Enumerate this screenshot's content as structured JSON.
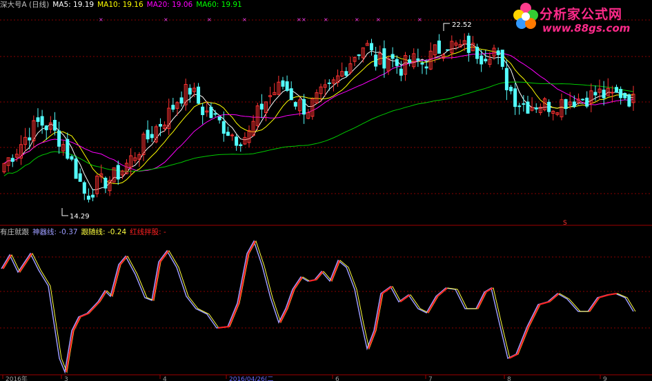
{
  "colors": {
    "background": "#000000",
    "up_candle": "#ff3232",
    "down_candle": "#54ffff",
    "ma5": "#ffffff",
    "ma10": "#ffff00",
    "ma20": "#ff00ff",
    "ma60": "#00cc00",
    "grid": "#8b0000",
    "osc_main": "#9c9cff",
    "osc_follow": "#ffff40",
    "osc_red": "#ff2020"
  },
  "top_panel": {
    "title": "深大号A (日线)",
    "ma5_label": "MA5:",
    "ma5_value": "19.19",
    "ma10_label": "MA10:",
    "ma10_value": "19.16",
    "ma20_label": "MA20:",
    "ma20_value": "19.06",
    "ma60_label": "MA60:",
    "ma60_value": "19.91",
    "high_marker": "22.52",
    "low_marker": "14.29",
    "s_marker": "S"
  },
  "bottom_panel": {
    "title": "有庄就跟",
    "main_label": "神器线:",
    "main_value": "-0.37",
    "follow_label": "跟随线:",
    "follow_value": "-0.24",
    "red_label": "红线拌股:",
    "red_value": "-"
  },
  "x_axis": {
    "labels": [
      "2016年",
      "3",
      "4",
      "2016/04/26(二",
      "6",
      "7",
      "8",
      "9"
    ]
  },
  "watermark": {
    "name": "分析家公式网",
    "url": "www.88gs.com"
  },
  "chart_data": [
    {
      "type": "candlestick",
      "title": "深大号A (日线)",
      "y_range_approx": [
        13.5,
        23.5
      ],
      "highest_marked": 22.52,
      "lowest_marked": 14.29,
      "moving_averages": [
        {
          "name": "MA5",
          "last": 19.19
        },
        {
          "name": "MA10",
          "last": 19.16
        },
        {
          "name": "MA20",
          "last": 19.06
        },
        {
          "name": "MA60",
          "last": 19.91
        }
      ],
      "close_path_approx": [
        16.2,
        16.8,
        17.6,
        18.2,
        17.9,
        17.2,
        16.0,
        14.6,
        15.2,
        15.4,
        15.8,
        16.5,
        17.2,
        17.9,
        18.5,
        19.4,
        19.8,
        18.8,
        18.4,
        17.9,
        17.4,
        17.6,
        18.9,
        19.6,
        20.0,
        19.2,
        18.8,
        19.4,
        19.8,
        20.6,
        21.4,
        22.0,
        21.0,
        21.4,
        20.8,
        21.2,
        21.0,
        21.6,
        22.0,
        21.8,
        21.8,
        21.4,
        21.8,
        20.2,
        19.2,
        19.0,
        19.1,
        19.0,
        19.2,
        19.3,
        19.4,
        19.6,
        19.4,
        19.6,
        19.2
      ]
    },
    {
      "type": "line",
      "title": "有庄就跟",
      "series": [
        {
          "name": "神器线",
          "last": -0.37
        },
        {
          "name": "跟随线",
          "last": -0.24
        }
      ]
    }
  ]
}
